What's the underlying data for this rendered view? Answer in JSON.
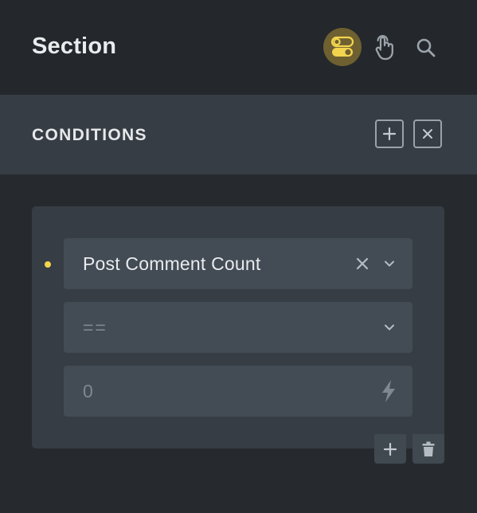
{
  "header": {
    "title": "Section",
    "icons": [
      "toggle-switch-icon",
      "pointer-hand-icon",
      "search-icon"
    ],
    "accent_color": "#f2d44e"
  },
  "conditions": {
    "title": "CONDITIONS",
    "icons": [
      "plus-icon",
      "close-icon"
    ]
  },
  "condition_row": {
    "indicator_color": "#f2d44e",
    "key": {
      "value": "Post Comment Count",
      "icons": [
        "clear-icon",
        "chevron-down-icon"
      ]
    },
    "operator": {
      "value": "==",
      "icons": [
        "chevron-down-icon"
      ]
    },
    "compare_value": {
      "placeholder": "0",
      "icons": [
        "lightning-bolt-icon"
      ]
    }
  },
  "row_actions": [
    "plus-icon",
    "trash-icon"
  ]
}
